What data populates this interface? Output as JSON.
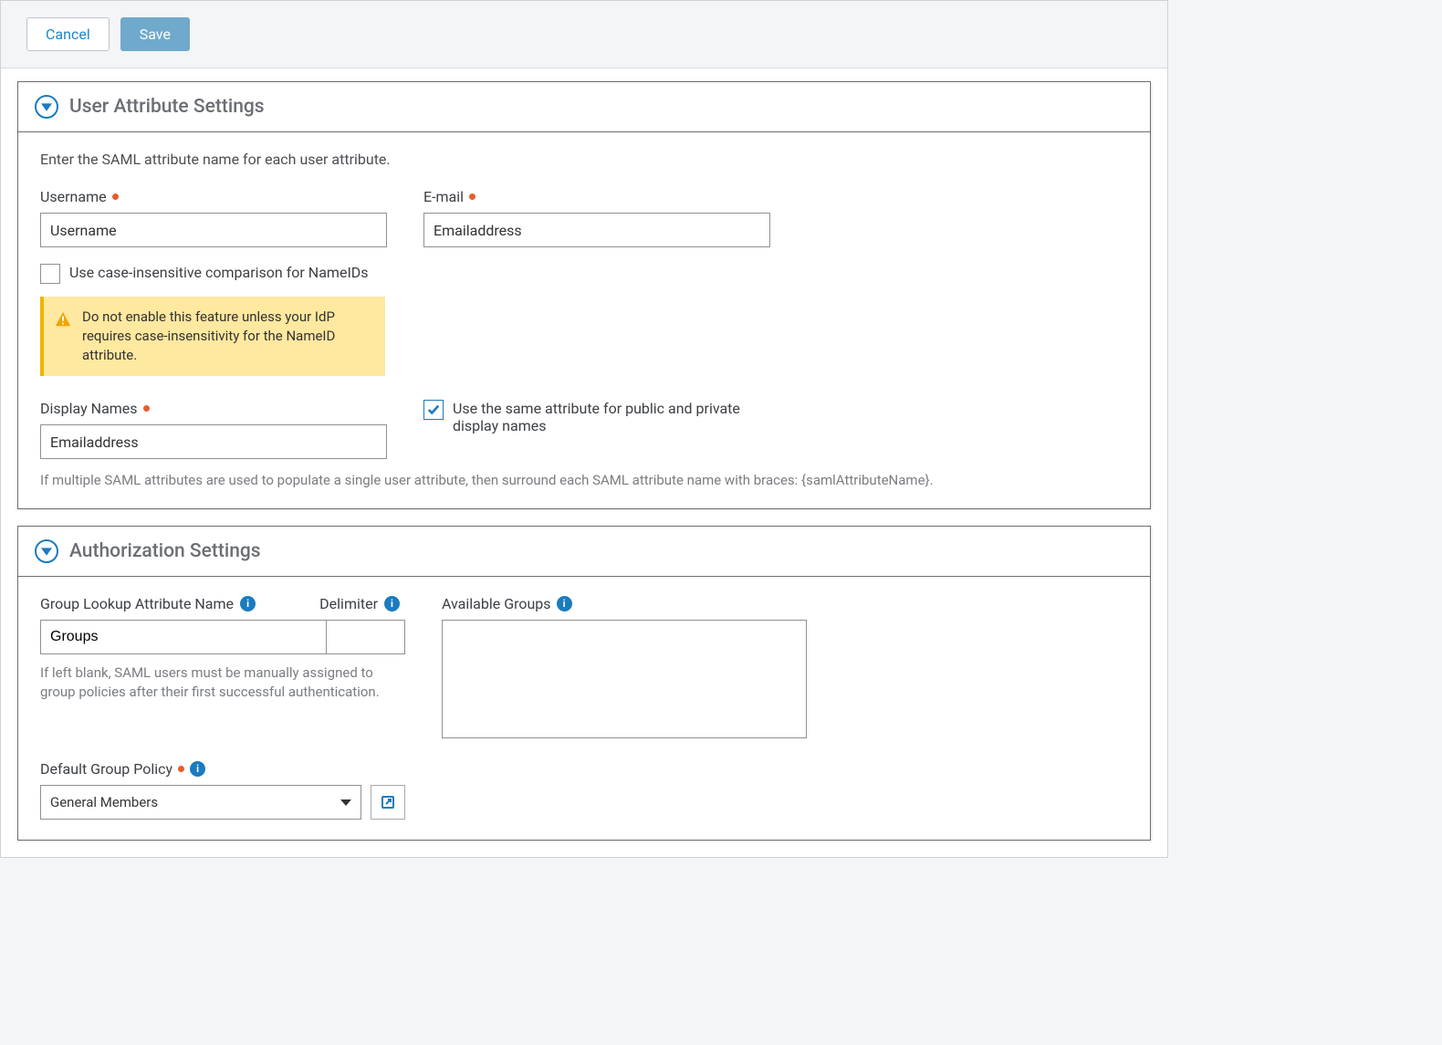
{
  "toolbar": {
    "cancel_label": "Cancel",
    "save_label": "Save"
  },
  "user_attr": {
    "title": "User Attribute Settings",
    "intro": "Enter the SAML attribute name for each user attribute.",
    "username_label": "Username",
    "username_value": "Username",
    "email_label": "E-mail",
    "email_value": "Emailaddress",
    "case_insensitive_label": "Use case-insensitive comparison for NameIDs",
    "warning_text": "Do not enable this feature unless your IdP requires case-insensitivity for the NameID attribute.",
    "display_names_label": "Display Names",
    "display_names_value": "Emailaddress",
    "same_attr_label": "Use the same attribute for public and private display names",
    "same_attr_checked": true,
    "bottom_hint": "If multiple SAML attributes are used to populate a single user attribute, then surround each SAML attribute name with braces: {samlAttributeName}."
  },
  "auth": {
    "title": "Authorization Settings",
    "group_lookup_label": "Group Lookup Attribute Name",
    "delimiter_label": "Delimiter",
    "group_lookup_value": "Groups",
    "group_hint": "If left blank, SAML users must be manually assigned to group policies after their first successful authentication.",
    "available_groups_label": "Available Groups",
    "default_policy_label": "Default Group Policy",
    "default_policy_value": "General Members"
  }
}
